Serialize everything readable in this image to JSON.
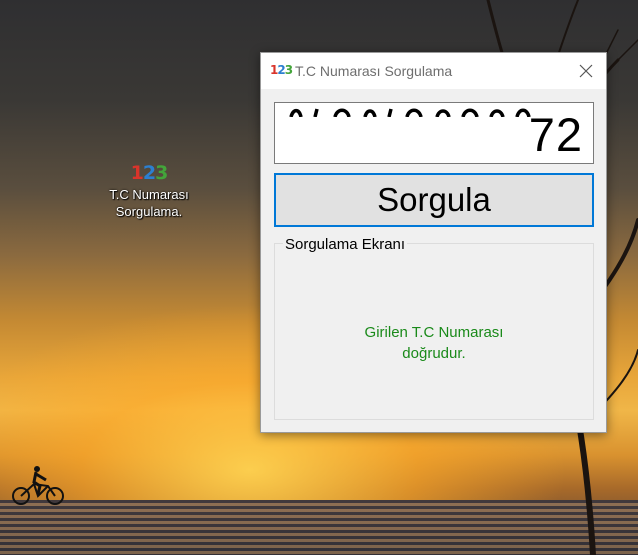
{
  "desktop": {
    "icon_label_line1": "T.C Numarası",
    "icon_label_line2": "Sorgulama."
  },
  "window": {
    "title": "T.C Numarası Sorgulama",
    "tc_input_value": "72",
    "query_button_label": "Sorgula",
    "group_title": "Sorgulama Ekranı",
    "result_line1": "Girilen T.C Numarası",
    "result_line2": "doğrudur."
  },
  "colors": {
    "result_text": "#1a8a1a",
    "button_border": "#0078d7"
  }
}
